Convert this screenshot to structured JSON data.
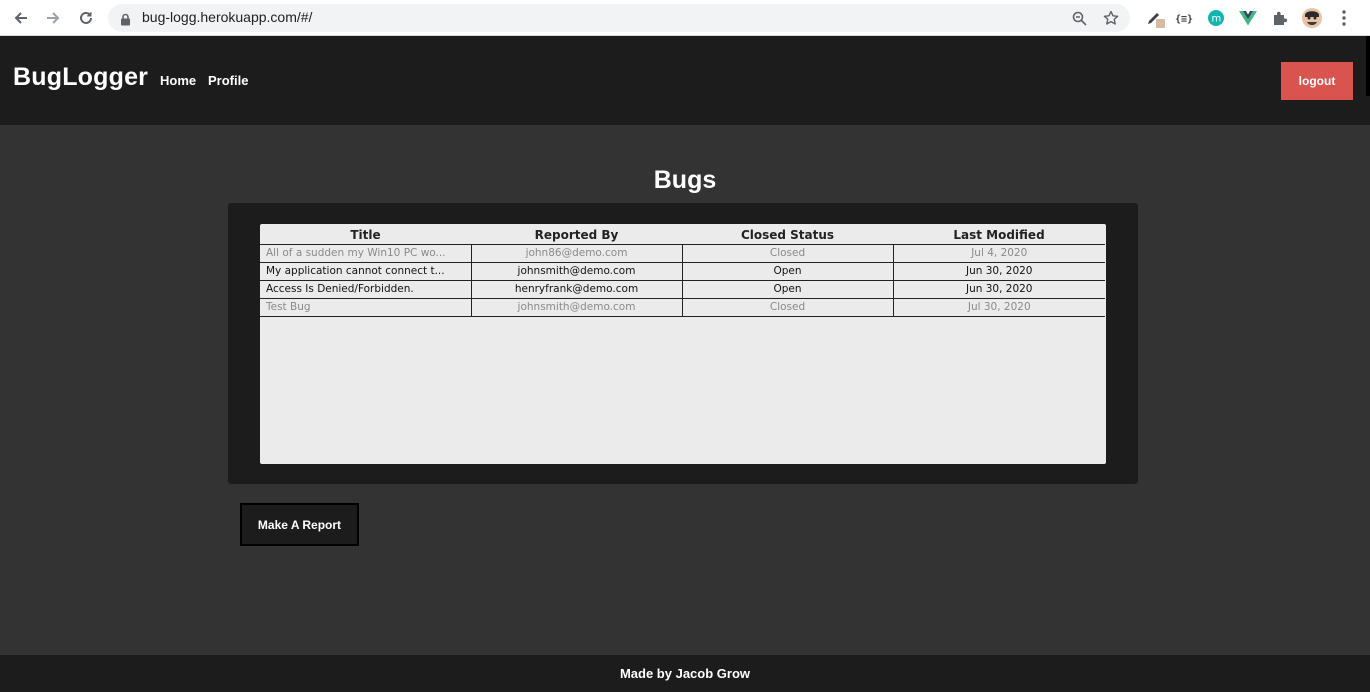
{
  "browser": {
    "url": "bug-logg.herokuapp.com/#/",
    "back_icon": "arrow-left",
    "forward_icon": "arrow-right",
    "reload_icon": "reload",
    "zoom_icon": "magnifier",
    "bookmark_icon": "star",
    "extensions": [
      "eyedropper",
      "json-viewer",
      "m-extension",
      "vue-devtools",
      "puzzle-piece",
      "profile-avatar"
    ],
    "menu_icon": "vertical-dots"
  },
  "header": {
    "brand": "BugLogger",
    "nav": {
      "home": "Home",
      "profile": "Profile"
    },
    "logout_label": "logout",
    "logout_color": "#d9534f"
  },
  "main": {
    "title": "Bugs",
    "table": {
      "columns": [
        "Title",
        "Reported By",
        "Closed Status",
        "Last Modified"
      ],
      "rows": [
        {
          "title": "All of a sudden my Win10 PC wo...",
          "reported_by": "john86@demo.com",
          "status": "Closed",
          "modified": "Jul 4, 2020"
        },
        {
          "title": "My application cannot connect t...",
          "reported_by": "johnsmith@demo.com",
          "status": "Open",
          "modified": "Jun 30, 2020"
        },
        {
          "title": "Access Is Denied/Forbidden.",
          "reported_by": "henryfrank@demo.com",
          "status": "Open",
          "modified": "Jun 30, 2020"
        },
        {
          "title": "Test Bug",
          "reported_by": "johnsmith@demo.com",
          "status": "Closed",
          "modified": "Jul 30, 2020"
        }
      ]
    },
    "report_button": "Make A Report"
  },
  "footer": {
    "text": "Made by Jacob Grow"
  },
  "colors": {
    "header_bg": "#1c1c1c",
    "page_bg": "#333333",
    "table_bg": "#ebebeb",
    "closed_text": "#8a8a8a"
  }
}
